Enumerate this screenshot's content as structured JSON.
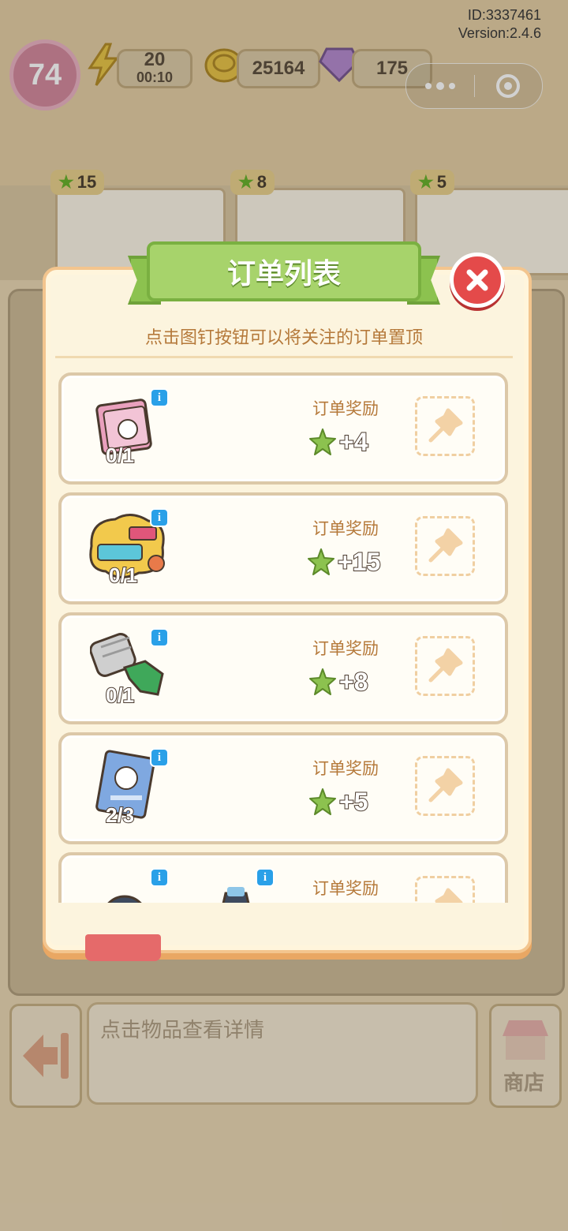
{
  "hud": {
    "id_text": "ID:3337461",
    "version_text": "Version:2.4.6",
    "level": "74",
    "energy": "20",
    "energy_timer": "00:10",
    "coins": "25164",
    "gems": "175"
  },
  "top_orders_rewards": [
    "15",
    "8",
    "5"
  ],
  "modal": {
    "title": "订单列表",
    "subtitle": "点击图钉按钮可以将关注的订单置顶",
    "reward_label": "订单奖励",
    "orders": [
      {
        "count": "0/1",
        "reward": "+4",
        "item_icon": "book-icon"
      },
      {
        "count": "0/1",
        "reward": "+15",
        "item_icon": "gym-sign-icon"
      },
      {
        "count": "0/1",
        "reward": "+8",
        "item_icon": "roller-tool-icon"
      },
      {
        "count": "2/3",
        "reward": "+5",
        "item_icon": "magazine-icon"
      },
      {
        "count": "",
        "reward": "",
        "item_icon": "wheel-icon"
      }
    ]
  },
  "bottom": {
    "detail_placeholder": "点击物品查看详情",
    "shop_label": "商店"
  },
  "colors": {
    "accent_green": "#a7d36b",
    "close_red": "#e44a4a",
    "text_brown": "#b5793a",
    "info_blue": "#2aa0e8"
  }
}
